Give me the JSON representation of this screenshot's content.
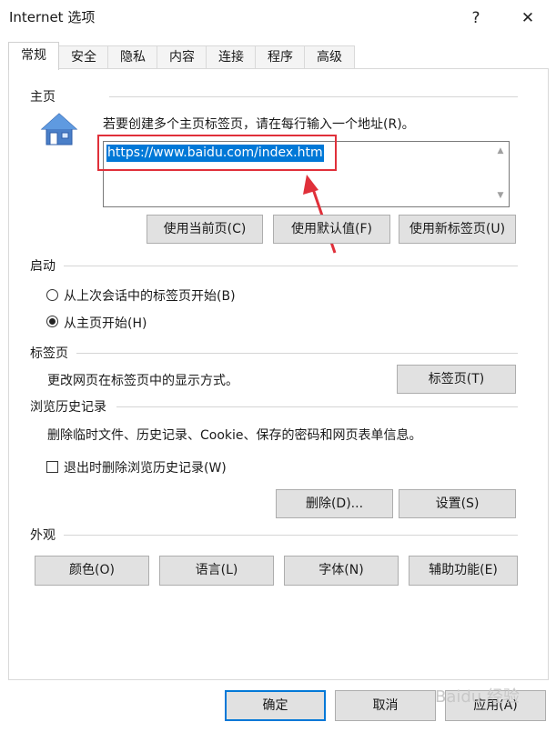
{
  "window": {
    "title": "Internet 选项",
    "help_glyph": "?",
    "close_glyph": "✕"
  },
  "tabs": [
    "常规",
    "安全",
    "隐私",
    "内容",
    "连接",
    "程序",
    "高级"
  ],
  "home": {
    "title": "主页",
    "instruction": "若要创建多个主页标签页，请在每行输入一个地址(R)。",
    "url": "https://www.baidu.com/index.htm",
    "buttons": [
      "使用当前页(C)",
      "使用默认值(F)",
      "使用新标签页(U)"
    ]
  },
  "startup": {
    "title": "启动",
    "options": [
      {
        "label": "从上次会话中的标签页开始(B)",
        "selected": false
      },
      {
        "label": "从主页开始(H)",
        "selected": true
      }
    ]
  },
  "tabs_section": {
    "title": "标签页",
    "description": "更改网页在标签页中的显示方式。",
    "button": "标签页(T)"
  },
  "history": {
    "title": "浏览历史记录",
    "description": "删除临时文件、历史记录、Cookie、保存的密码和网页表单信息。",
    "checkbox_label": "退出时删除浏览历史记录(W)",
    "checkbox_checked": false,
    "delete_button": "删除(D)...",
    "settings_button": "设置(S)"
  },
  "appearance": {
    "title": "外观",
    "buttons": [
      "颜色(O)",
      "语言(L)",
      "字体(N)",
      "辅助功能(E)"
    ]
  },
  "footer": {
    "ok": "确定",
    "cancel": "取消",
    "apply": "应用(A)"
  },
  "watermark": "Baidu 经验",
  "colors": {
    "selection": "#0078d7",
    "annotation_red": "#e0303a",
    "button_bg": "#e1e1e1"
  }
}
